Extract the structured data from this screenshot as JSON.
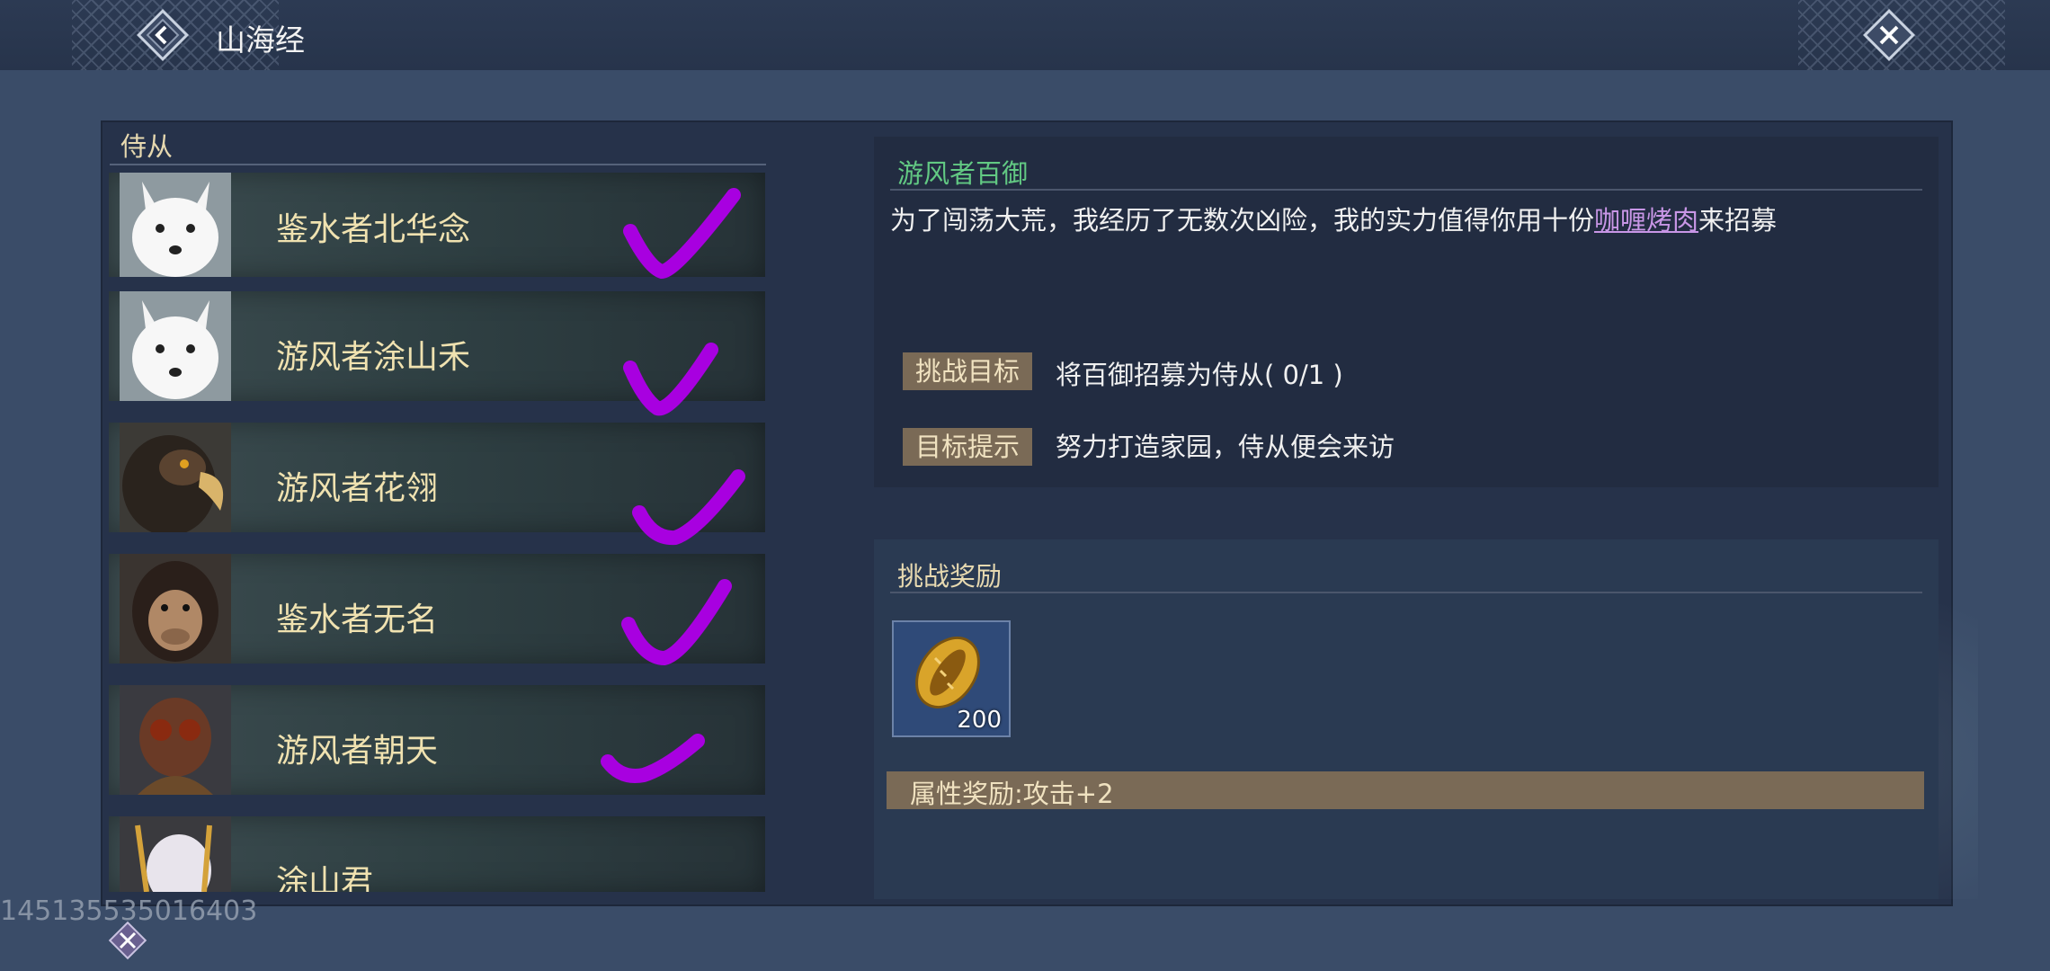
{
  "header": {
    "title": "山海经"
  },
  "left_panel": {
    "header": "侍从",
    "cards": [
      {
        "name": "鉴水者北华念",
        "portrait": "white-fox",
        "checked": true
      },
      {
        "name": "游风者涂山禾",
        "portrait": "white-fox",
        "checked": true
      },
      {
        "name": "游风者花翎",
        "portrait": "eagle",
        "checked": true
      },
      {
        "name": "鉴水者无名",
        "portrait": "chimpanzee",
        "checked": true
      },
      {
        "name": "游风者朝天",
        "portrait": "insect-warrior",
        "checked": true
      },
      {
        "name": "涂山君",
        "portrait": "white-hair-lady",
        "checked": false
      }
    ]
  },
  "detail": {
    "title": "游风者百御",
    "desc_prefix": "为了闯荡大荒，我经历了无数次凶险，我的实力值得你用十份",
    "desc_highlight": "咖喱烤肉",
    "desc_suffix": "来招募",
    "challenge_tag": "挑战目标",
    "challenge_value": "将百御招募为侍从( 0/1 )",
    "hint_tag": "目标提示",
    "hint_value": "努力打造家园，侍从便会来访"
  },
  "reward": {
    "title": "挑战奖励",
    "item_icon": "gold-shell-coin",
    "item_count": "200",
    "attribute": "属性奖励:攻击+2"
  },
  "watermark": "14513553501640​3",
  "colors": {
    "accent_title": "#62c983",
    "gold_text": "#f0e2b0",
    "highlight": "#c896e6",
    "check_mark": "#a800e0"
  }
}
